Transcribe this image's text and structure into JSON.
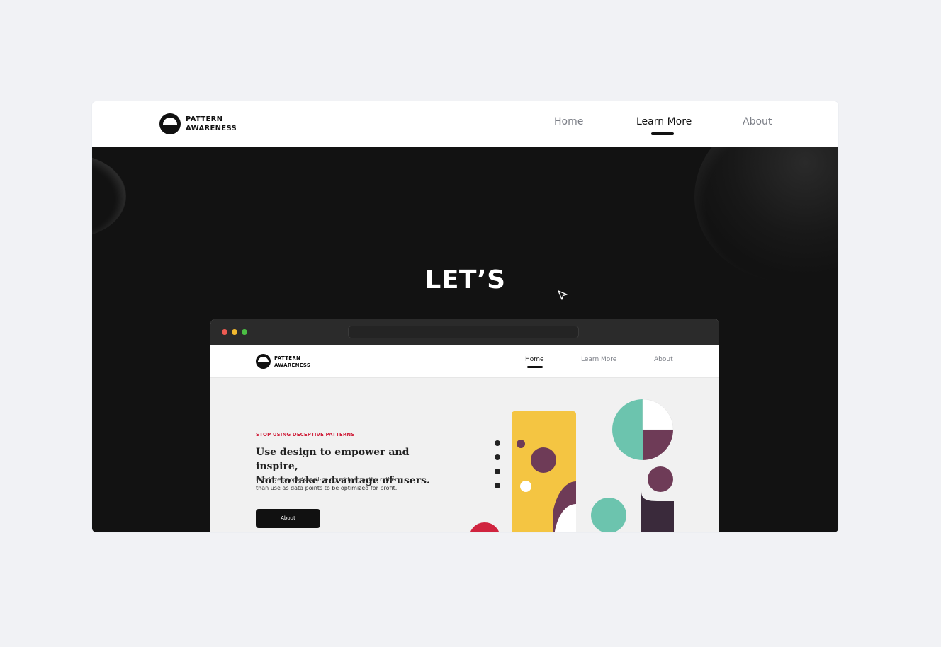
{
  "outer_nav": {
    "logo_line1": "PATTERN",
    "logo_line2": "AWARENESS",
    "links": [
      "Home",
      "Learn More",
      "About"
    ],
    "active_link": "Learn More"
  },
  "hero": {
    "headline": "LET’S"
  },
  "inner_site": {
    "logo_line1": "PATTERN",
    "logo_line2": "AWARENESS",
    "links": [
      "Home",
      "Learn More",
      "About"
    ],
    "active_link": "Home",
    "eyebrow": "STOP USING DECEPTIVE PATTERNS",
    "title_line1": "Use design to empower and inspire,",
    "title_line2": "Not to take advantage of users.",
    "desc_line1": "Prioritize people's well-being with empathy rather",
    "desc_line2": "than use as data points to be optimized for profit.",
    "button_label": "About"
  },
  "colors": {
    "page_bg": "#f1f2f5",
    "hero_bg": "#121212",
    "accent_red": "#d0243f",
    "yellow": "#f4c542",
    "plum": "#6e3b57",
    "teal": "#6cc4ae",
    "dark_plum": "#3a2a3b"
  },
  "icons": {
    "cursor": "pointer-cursor-icon",
    "logo": "half-circle-logo-icon"
  }
}
